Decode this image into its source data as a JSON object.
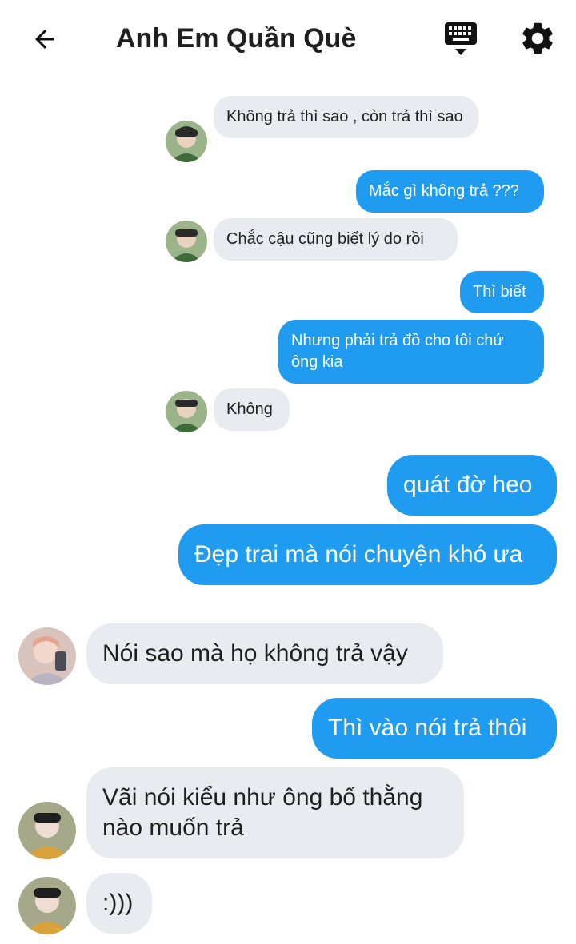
{
  "header": {
    "title": "Anh Em Quần Què"
  },
  "icons": {
    "back": "arrow-left-icon",
    "keyboard": "keyboard-icon",
    "settings": "gear-icon"
  },
  "colors": {
    "outgoing_bubble": "#1f9cf0",
    "incoming_bubble": "#e8ecf1"
  },
  "messages": [
    {
      "side": "in",
      "text": "Không trả thì sao , còn trả thì sao"
    },
    {
      "side": "out",
      "text": "Mắc gì không trả ???"
    },
    {
      "side": "in",
      "text": "Chắc cậu cũng biết lý do rồi"
    },
    {
      "side": "out",
      "text": "Thì biết"
    },
    {
      "side": "out",
      "text": "Nhưng phải trả đồ cho tôi chứ ông kia"
    },
    {
      "side": "in",
      "text": "Không"
    },
    {
      "side": "out",
      "text": "quát đờ heo"
    },
    {
      "side": "out",
      "text": "Đẹp trai mà nói chuyện khó ưa"
    },
    {
      "side": "in",
      "text": "Nói sao mà họ không trả vậy"
    },
    {
      "side": "out",
      "text": "Thì vào nói trả thôi"
    },
    {
      "side": "in",
      "text": "Vãi nói kiểu như ông bố thằng nào muốn trả"
    },
    {
      "side": "in",
      "text": ":)))"
    }
  ]
}
